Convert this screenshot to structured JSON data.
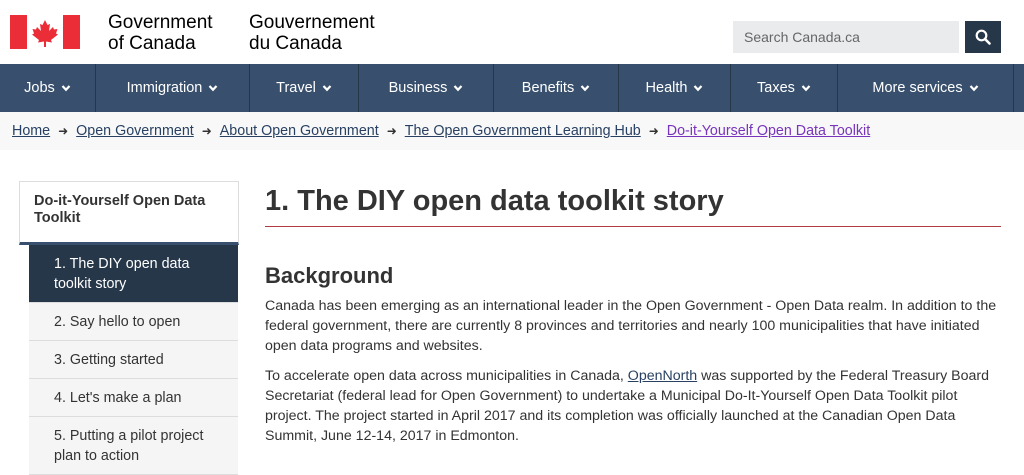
{
  "header": {
    "signature_en": [
      "Government",
      "of Canada"
    ],
    "signature_fr": [
      "Gouvernement",
      "du Canada"
    ],
    "flag_color": "#eb2d37",
    "search_placeholder": "Search Canada.ca"
  },
  "nav": {
    "items": [
      {
        "label": "Jobs"
      },
      {
        "label": "Immigration"
      },
      {
        "label": "Travel"
      },
      {
        "label": "Business"
      },
      {
        "label": "Benefits"
      },
      {
        "label": "Health"
      },
      {
        "label": "Taxes"
      },
      {
        "label": "More services"
      }
    ]
  },
  "breadcrumb": {
    "items": [
      "Home",
      "Open Government",
      "About Open Government",
      "The Open Government Learning Hub",
      "Do-it-Yourself Open Data Toolkit"
    ]
  },
  "sidebar": {
    "heading": "Do-it-Yourself Open Data Toolkit",
    "items": [
      {
        "label": "1. The DIY open data toolkit story",
        "active": true
      },
      {
        "label": "2. Say hello to open",
        "active": false
      },
      {
        "label": "3. Getting started",
        "active": false
      },
      {
        "label": "4. Let's make a plan",
        "active": false
      },
      {
        "label": "5. Putting a pilot project plan to action",
        "active": false
      }
    ]
  },
  "main": {
    "title": "1. The DIY open data toolkit story",
    "section_heading": "Background",
    "paragraph1": "Canada has been emerging as an international leader in the Open Government - Open Data realm. In addition to the federal government, there are currently 8 provinces and territories and nearly 100 municipalities that have initiated open data programs and websites.",
    "paragraph2_before": "To accelerate open data across municipalities in Canada, ",
    "paragraph2_link": "OpenNorth",
    "paragraph2_after": " was supported by the Federal Treasury Board Secretariat (federal lead for Open Government) to undertake a Municipal Do-It-Yourself Open Data Toolkit pilot project. The project started in April 2017 and its completion was officially launched at the Canadian Open Data Summit, June 12-14, 2017 in Edmonton."
  }
}
